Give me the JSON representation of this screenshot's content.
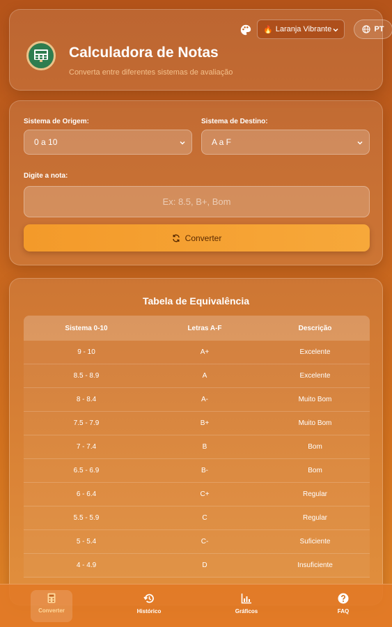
{
  "header": {
    "title": "Calculadora de Notas",
    "subtitle": "Converta entre diferentes sistemas de avaliação",
    "theme_select": {
      "icon": "fire-emoji",
      "label": "Laranja Vibrante"
    },
    "language_button": "PT"
  },
  "converter": {
    "origin_label": "Sistema de Origem:",
    "origin_value": "0 a 10",
    "target_label": "Sistema de Destino:",
    "target_value": "A a F",
    "input_label": "Digite a nota:",
    "input_placeholder": "Ex: 8.5, B+, Bom",
    "convert_button": "Converter"
  },
  "table": {
    "title": "Tabela de Equivalência",
    "headers": [
      "Sistema 0-10",
      "Letras A-F",
      "Descrição"
    ],
    "rows": [
      [
        "9 - 10",
        "A+",
        "Excelente"
      ],
      [
        "8.5 - 8.9",
        "A",
        "Excelente"
      ],
      [
        "8 - 8.4",
        "A-",
        "Muito Bom"
      ],
      [
        "7.5 - 7.9",
        "B+",
        "Muito Bom"
      ],
      [
        "7 - 7.4",
        "B",
        "Bom"
      ],
      [
        "6.5 - 6.9",
        "B-",
        "Bom"
      ],
      [
        "6 - 6.4",
        "C+",
        "Regular"
      ],
      [
        "5.5 - 5.9",
        "C",
        "Regular"
      ],
      [
        "5 - 5.4",
        "C-",
        "Suficiente"
      ],
      [
        "4 - 4.9",
        "D",
        "Insuficiente"
      ]
    ]
  },
  "nav": {
    "items": [
      {
        "label": "Converter",
        "icon": "calculator-icon",
        "active": true
      },
      {
        "label": "Histórico",
        "icon": "history-icon",
        "active": false
      },
      {
        "label": "Gráficos",
        "icon": "chart-icon",
        "active": false
      },
      {
        "label": "FAQ",
        "icon": "question-icon",
        "active": false
      }
    ]
  },
  "colors": {
    "accent": "#f39a2a",
    "background": "#c4631e",
    "active_nav": "#ffd79a"
  }
}
